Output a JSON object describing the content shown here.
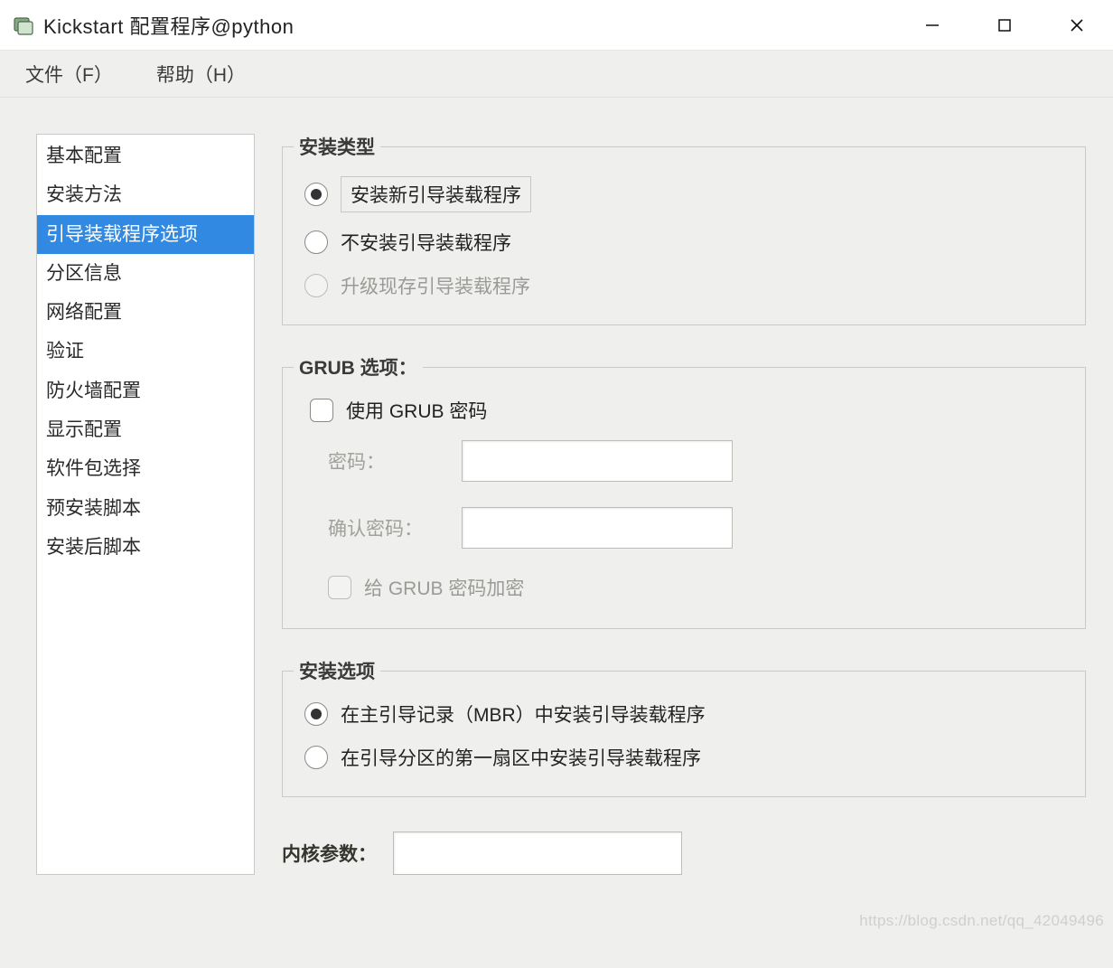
{
  "window": {
    "title": "Kickstart 配置程序@python"
  },
  "menu": {
    "file": "文件（F）",
    "help": "帮助（H）"
  },
  "sidebar": {
    "items": [
      "基本配置",
      "安装方法",
      "引导装载程序选项",
      "分区信息",
      "网络配置",
      "验证",
      "防火墙配置",
      "显示配置",
      "软件包选择",
      "预安装脚本",
      "安装后脚本"
    ],
    "selected_index": 2
  },
  "install_type": {
    "title": "安装类型",
    "options": {
      "install_new": "安装新引导装载程序",
      "no_install": "不安装引导装载程序",
      "upgrade": "升级现存引导装载程序"
    }
  },
  "grub": {
    "title": "GRUB 选项：",
    "use_password_label": "使用 GRUB 密码",
    "password_label": "密码：",
    "confirm_label": "确认密码：",
    "encrypt_label": "给 GRUB 密码加密",
    "password_value": "",
    "confirm_value": ""
  },
  "install_options": {
    "title": "安装选项",
    "mbr": "在主引导记录（MBR）中安装引导装载程序",
    "first_sector": "在引导分区的第一扇区中安装引导装载程序"
  },
  "kernel": {
    "label": "内核参数：",
    "value": ""
  },
  "watermark": "https://blog.csdn.net/qq_42049496"
}
